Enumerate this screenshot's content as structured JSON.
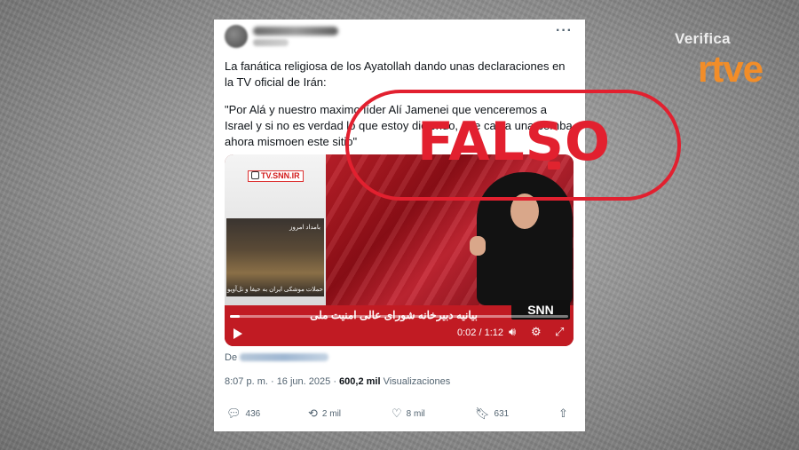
{
  "brand": {
    "line1": "Verifica",
    "line2": "rtve",
    "accent": "#f28d28"
  },
  "stamp": {
    "text": "FALSO",
    "color": "#e2202f"
  },
  "tweet": {
    "more_icon": "more-horizontal-icon",
    "paragraph1": "La fanática religiosa de los Ayatollah dando unas declaraciones en la TV oficial de Irán:",
    "paragraph2": "\"Por Alá y nuestro maximo líder Alí Jamenei que venceremos a Israel y si no es verdad lo que estoy diciendo, que caiga una bomba ahora mismoen este sitio\"",
    "video": {
      "watermark": "TV.SNN.IR",
      "inset_tag": "بامداد امروز",
      "inset_caption": "حملات موشکی ایران به حیفا و تل‌آویو",
      "ticker": "بیانیه دبیرخانه شورای عالی امنیت ملی",
      "channel_logo": "SNN",
      "timecode": "0:02 / 1:12",
      "progress": 0.03
    },
    "from_label": "De",
    "timestamp": "8:07 p. m. · 16 jun. 2025",
    "views_count": "600,2 mil",
    "views_label": "Visualizaciones",
    "actions": {
      "replies": "436",
      "retweets": "2 mil",
      "likes": "8 mil",
      "bookmarks": "631"
    }
  }
}
